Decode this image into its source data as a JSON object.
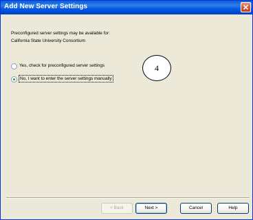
{
  "window": {
    "title": "Add New Server Settings",
    "close_icon": "close-icon"
  },
  "intro": {
    "line1": "Preconfigured server settings may be available for:",
    "line2": "California State University Consortium"
  },
  "options": [
    {
      "label": "Yes, check for preconfigured server settings",
      "selected": false
    },
    {
      "label": "No, I want to enter the server settings manually",
      "selected": true
    }
  ],
  "callout": {
    "number": "4"
  },
  "buttons": {
    "back": "< Back",
    "next": "Next >",
    "cancel": "Cancel",
    "help": "Help"
  },
  "colors": {
    "titlebar": "#0058e6",
    "dialog_bg": "#ece9d8",
    "radio_dot": "#21a121"
  }
}
